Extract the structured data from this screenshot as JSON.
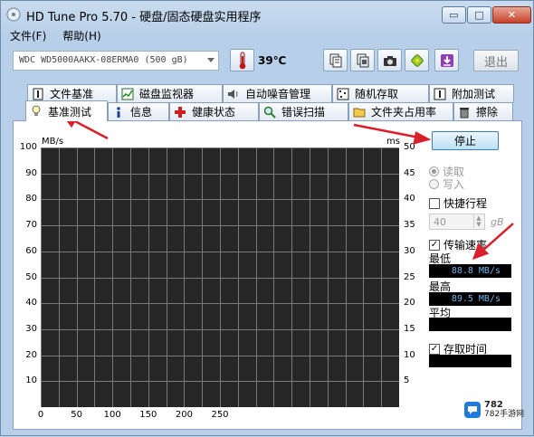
{
  "window": {
    "title": "HD Tune Pro 5.70 - 硬盘/固态硬盘实用程序",
    "min_glyph": "▭",
    "max_glyph": "□",
    "close_glyph": "✕"
  },
  "menu": {
    "file": "文件(F)",
    "help": "帮助(H)"
  },
  "toolbar": {
    "drive": "WDC WD5000AAKX-08ERMA0 (500 gB)",
    "temperature": "39℃",
    "exit_label": "退出",
    "icons": [
      "copy-info-icon",
      "copy-screen-icon",
      "camera-icon",
      "health-icon",
      "download-icon"
    ]
  },
  "tabs": {
    "row1": [
      "文件基准",
      "磁盘监视器",
      "自动噪音管理",
      "随机存取",
      "附加测试"
    ],
    "row2": [
      "基准测试",
      "信息",
      "健康状态",
      "错误扫描",
      "文件夹占用率",
      "擦除"
    ]
  },
  "chart": {
    "y_unit_left": "MB/s",
    "y_unit_right": "ms",
    "y_ticks_left": [
      "100",
      "90",
      "80",
      "70",
      "60",
      "50",
      "40",
      "30",
      "20",
      "10"
    ],
    "y_ticks_right": [
      "50",
      "45",
      "40",
      "35",
      "30",
      "25",
      "20",
      "15",
      "10",
      "5"
    ],
    "x_ticks": [
      "0",
      "50",
      "100",
      "150",
      "200",
      "250"
    ]
  },
  "controls": {
    "stop_label": "停止",
    "read_label": "读取",
    "write_label": "写入",
    "quick_label": "快捷行程",
    "quick_value": "40",
    "quick_unit": "gB",
    "transfer_label": "传输速率",
    "min_label": "最低",
    "min_value": "88.8 MB/s",
    "max_label": "最高",
    "max_value": "89.5 MB/s",
    "avg_label": "平均",
    "access_label": "存取时间"
  },
  "watermark": {
    "number": "782",
    "line1": "782手游网"
  },
  "colors": {
    "plot_bg": "#262626",
    "grid": "#7a7a7a",
    "readout_text": "#6fb3e8",
    "annotation_arrow": "#d9202a"
  }
}
